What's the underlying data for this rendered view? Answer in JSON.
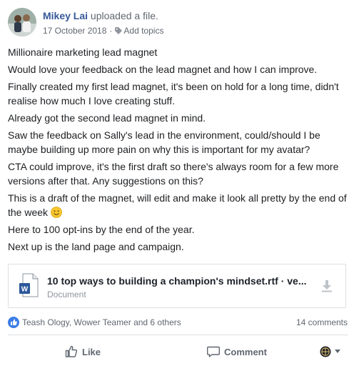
{
  "post": {
    "author": "Mikey Lai",
    "action": "uploaded a file.",
    "date": "17 October 2018",
    "separator": "·",
    "add_topics": "Add topics"
  },
  "body": [
    "Millionaire marketing lead magnet",
    "Would love your feedback on the lead magnet and how I can improve.",
    "Finally created my first lead magnet, it's been on hold for a long time, didn't realise how much I love creating stuff.",
    "Already got the second lead magnet in mind.",
    "Saw the feedback on Sally's lead in the environment, could/should I be maybe building up more pain on why this is important for my avatar?",
    "CTA could improve, it's the first draft so there's always room for a few more versions after that. Any suggestions on this?",
    "This is a draft of the magnet, will edit and make it look all pretty by the end of the week",
    "Here to 100 opt-ins by the end of the year.",
    "Next up is the land page and campaign."
  ],
  "attachment": {
    "title": "10 top ways to building a champion's mindset.rtf · ve...",
    "subtitle": "Document",
    "file_badge": "W"
  },
  "reactions": {
    "names": "Teash Ology, Wower Teamer and 6 others",
    "comments": "14 comments"
  },
  "buttons": {
    "like": "Like",
    "comment": "Comment"
  },
  "colors": {
    "link": "#365899",
    "like_badge": "#3b7de6",
    "word_blue": "#2b579a"
  },
  "icons": {
    "tag": "tag-icon",
    "doc": "word-document-icon",
    "download": "download-icon",
    "like": "thumbs-up-icon",
    "comment": "comment-bubble-icon",
    "share": "globe-icon",
    "emoji": "smiley-emoji-icon"
  }
}
